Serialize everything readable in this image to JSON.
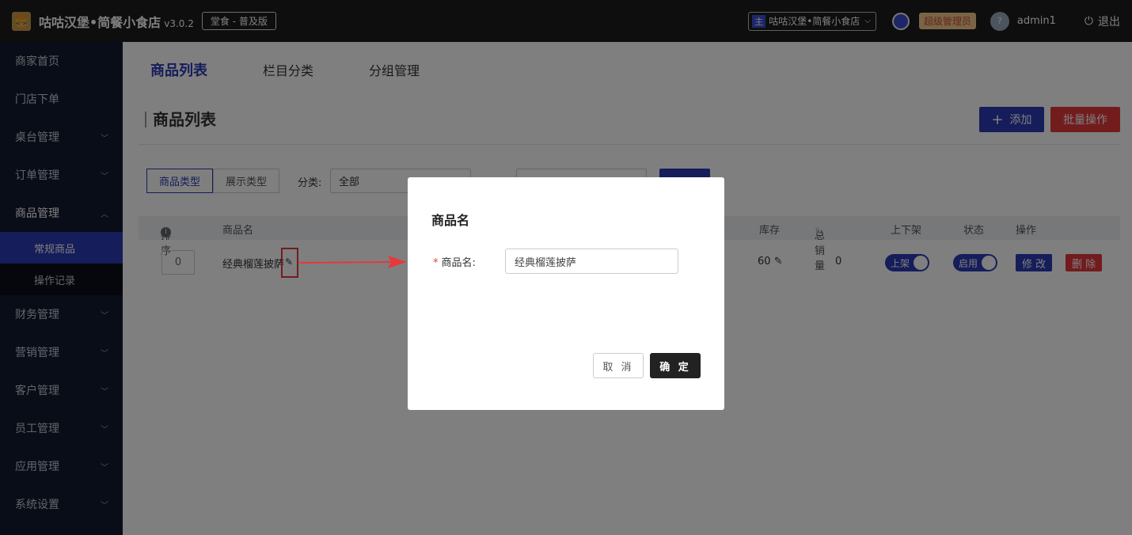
{
  "topbar": {
    "brand": "咕咕汉堡•简餐小食店",
    "version": "v3.0.2",
    "edition": "堂食 - 普及版",
    "shop_tag": "主",
    "shop": "咕咕汉堡•简餐小食店",
    "role": "超级管理员",
    "user": "admin1",
    "logout": "退出"
  },
  "sidebar": {
    "items": [
      "商家首页",
      "门店下单",
      "桌台管理",
      "订单管理",
      "商品管理",
      "财务管理",
      "营销管理",
      "客户管理",
      "员工管理",
      "应用管理",
      "系统设置"
    ],
    "subitems": [
      "常规商品",
      "操作记录"
    ]
  },
  "tabs": [
    "商品列表",
    "栏目分类",
    "分组管理"
  ],
  "panel": {
    "title": "商品列表",
    "add": "添加",
    "batch": "批量操作",
    "seg_type": "商品类型",
    "seg_show": "展示类型",
    "cat_label": "分类:",
    "cat_value": "全部"
  },
  "table": {
    "headers": [
      "排序",
      "商品名",
      "库存",
      "总销量",
      "上下架",
      "状态",
      "操作"
    ],
    "row": {
      "sort": "0",
      "name": "经典榴莲披萨",
      "stock": "60",
      "sales": "0",
      "shelf": "上架",
      "status": "启用",
      "edit": "修 改",
      "delete": "删 除"
    }
  },
  "modal": {
    "title": "商品名",
    "label": "商品名:",
    "value": "经典榴莲披萨",
    "cancel": "取 消",
    "ok": "确 定"
  },
  "colors": {
    "accent": "#2b3ab5",
    "danger": "#e5393c",
    "sidebar": "#131b2e",
    "topbar": "#1d1d1d"
  }
}
